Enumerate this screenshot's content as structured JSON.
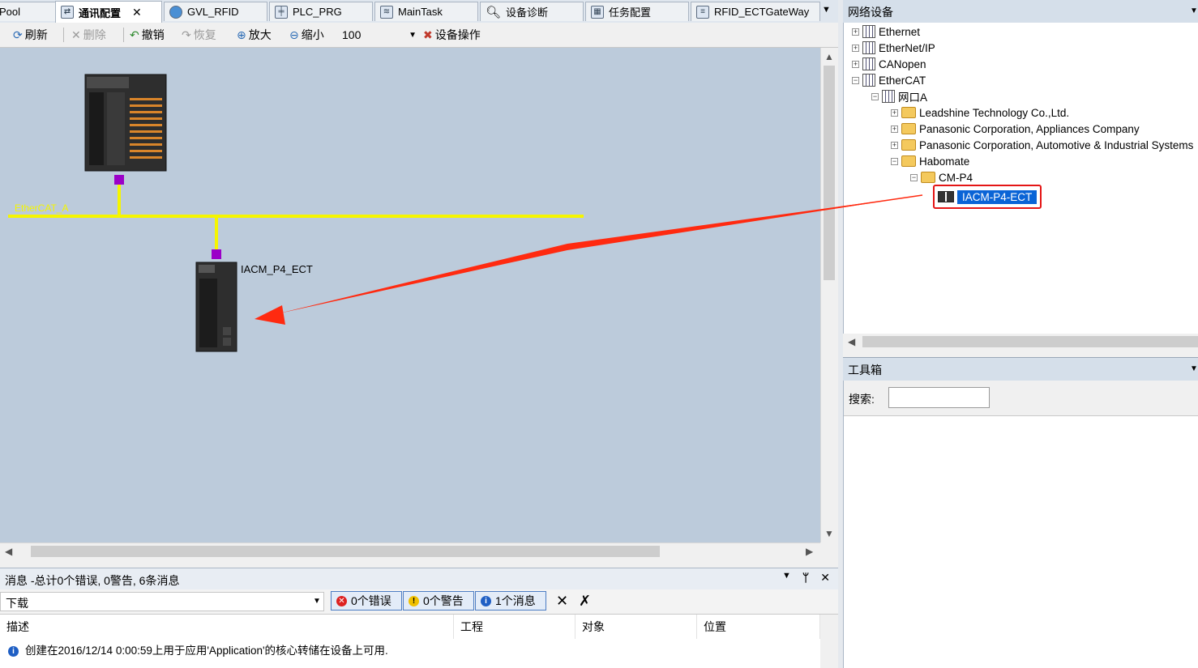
{
  "tabs": [
    {
      "label": "Pool",
      "icon": "pool-icon",
      "active": false
    },
    {
      "label": "通讯配置",
      "icon": "network-config-icon",
      "active": true
    },
    {
      "label": "GVL_RFID",
      "icon": "globe-icon",
      "active": false
    },
    {
      "label": "PLC_PRG",
      "icon": "program-icon",
      "active": false
    },
    {
      "label": "MainTask",
      "icon": "task-icon",
      "active": false
    },
    {
      "label": "设备诊断",
      "icon": "magnifier-icon",
      "active": false
    },
    {
      "label": "任务配置",
      "icon": "task-config-icon",
      "active": false
    },
    {
      "label": "RFID_ECTGateWay",
      "icon": "document-icon",
      "active": false
    }
  ],
  "toolbar": {
    "refresh": "刷新",
    "delete": "删除",
    "undo": "撤销",
    "redo": "恢复",
    "zoom_in": "放大",
    "zoom_out": "缩小",
    "zoom_value": "100",
    "device_ops": "设备操作"
  },
  "diagram": {
    "bus_label": "EtherCAT_A",
    "slave_label": "IACM_P4_ECT",
    "bus_color": "#f5f500",
    "port_color": "#9b00c8",
    "arrow_color": "#ff2a10"
  },
  "messages": {
    "title": "消息 -总计0个错误, 0警告, 6条消息",
    "source": "下载",
    "errors": "0个错误",
    "warnings": "0个警告",
    "infos": "1个消息",
    "columns": [
      "描述",
      "工程",
      "对象",
      "位置"
    ],
    "rows": [
      {
        "description": "创建在2016/12/14 0:00:59上用于应用'Application'的核心转储在设备上可用.",
        "project": "",
        "object": "",
        "position": ""
      }
    ]
  },
  "network_devices": {
    "title": "网络设备",
    "tree": [
      {
        "label": "Ethernet",
        "expander": "+"
      },
      {
        "label": "EtherNet/IP",
        "expander": "+"
      },
      {
        "label": "CANopen",
        "expander": "+"
      },
      {
        "label": "EtherCAT",
        "expander": "-"
      },
      {
        "label": "网口A",
        "expander": "-"
      },
      {
        "label": "Leadshine Technology Co.,Ltd.",
        "expander": "+"
      },
      {
        "label": "Panasonic Corporation, Appliances Company",
        "expander": "+"
      },
      {
        "label": "Panasonic Corporation, Automotive & Industrial Systems",
        "expander": "+"
      },
      {
        "label": "Habomate",
        "expander": "-"
      },
      {
        "label": "CM-P4",
        "expander": "-"
      },
      {
        "label": "IACM-P4-ECT",
        "expander": ""
      }
    ],
    "selected": "IACM-P4-ECT"
  },
  "toolbox": {
    "title": "工具箱",
    "search_label": "搜索:",
    "search_value": ""
  }
}
